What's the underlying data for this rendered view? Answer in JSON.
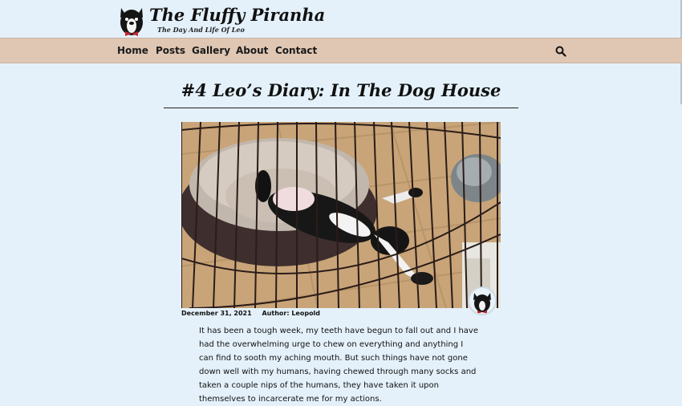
{
  "site": {
    "title": "The Fluffy Piranha",
    "tagline": "The Day And Life Of Leo"
  },
  "nav": {
    "items": [
      {
        "label": "Home"
      },
      {
        "label": "Posts"
      },
      {
        "label": "Gallery"
      },
      {
        "label": "About"
      },
      {
        "label": "Contact"
      }
    ],
    "search_icon": "search-icon"
  },
  "post": {
    "title": "#4 Leo’s Diary: In The Dog House",
    "date": "December 31, 2021",
    "author": "Author: Leopold",
    "body": "It has been a tough week, my teeth have begun to fall out and I have had the overwhelming urge to chew on everything and anything I can find to sooth my aching mouth. But such things have not gone down well with my humans, having chewed through many socks and taken a couple nips of the humans, they have taken it upon themselves to incarcerate me for my actions."
  },
  "colors": {
    "page_background": "#e4f1fb",
    "nav_background": "#dfc7b4"
  }
}
